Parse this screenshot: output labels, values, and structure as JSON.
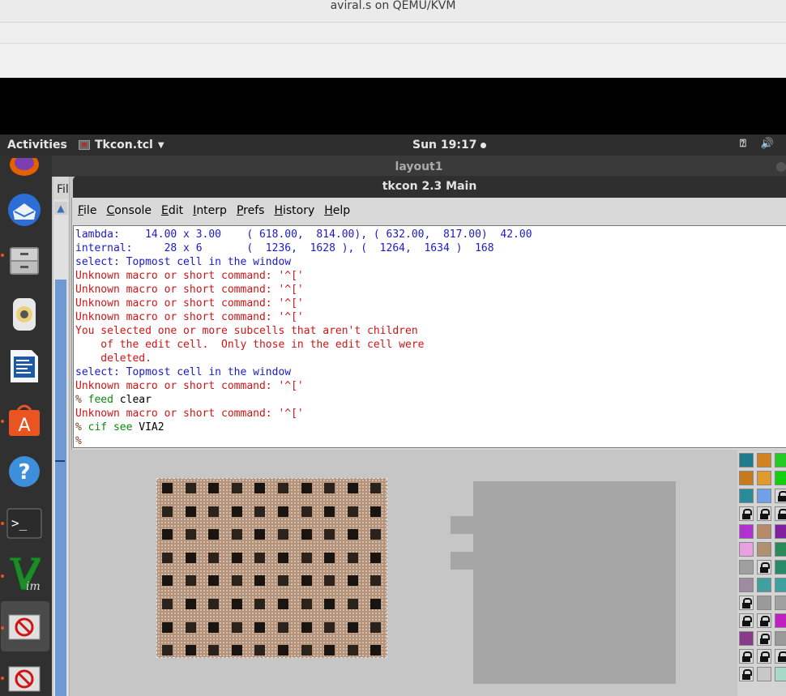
{
  "host": {
    "title": "aviral.s on QEMU/KVM"
  },
  "top_panel": {
    "activities": "Activities",
    "app_name": "Tkcon.tcl",
    "clock": "Sun 19:17"
  },
  "dock": {
    "items": [
      "firefox-icon",
      "thunderbird-icon",
      "files-icon",
      "rhythmbox-icon",
      "writer-icon",
      "software-icon",
      "help-icon",
      "terminal-icon",
      "vim-icon",
      "magic-icon",
      "magic-icon"
    ]
  },
  "layout_window": {
    "title": "layout1",
    "menu_fragment": "Fil"
  },
  "tkcon": {
    "title": "tkcon 2.3 Main",
    "menu": [
      {
        "label": "File",
        "ul": "F",
        "rest": "ile"
      },
      {
        "label": "Console",
        "ul": "C",
        "rest": "onsole"
      },
      {
        "label": "Edit",
        "ul": "E",
        "rest": "dit"
      },
      {
        "label": "Interp",
        "ul": "I",
        "rest": "nterp"
      },
      {
        "label": "Prefs",
        "ul": "P",
        "rest": "refs"
      },
      {
        "label": "History",
        "ul": "H",
        "rest": "istory"
      },
      {
        "label": "Help",
        "ul": "H",
        "rest": "elp"
      }
    ],
    "lines": [
      {
        "kind": "stdout",
        "text": "lambda:    14.00 x 3.00    ( 618.00,  814.00), ( 632.00,  817.00)  42.00"
      },
      {
        "kind": "stdout",
        "text": "internal:     28 x 6       (  1236,  1628 ), (  1264,  1634 )  168"
      },
      {
        "kind": "stdout",
        "text": "select: Topmost cell in the window"
      },
      {
        "kind": "stderr",
        "text": "Unknown macro or short command: '^['"
      },
      {
        "kind": "stderr",
        "text": "Unknown macro or short command: '^['"
      },
      {
        "kind": "stderr",
        "text": "Unknown macro or short command: '^['"
      },
      {
        "kind": "stderr",
        "text": "Unknown macro or short command: '^['"
      },
      {
        "kind": "stderr",
        "text": "You selected one or more subcells that aren't children"
      },
      {
        "kind": "stderr",
        "text": "    of the edit cell.  Only those in the edit cell were"
      },
      {
        "kind": "stderr",
        "text": "    deleted."
      },
      {
        "kind": "stdout",
        "text": "select: Topmost cell in the window"
      },
      {
        "kind": "stderr",
        "text": "Unknown macro or short command: '^['"
      },
      {
        "kind": "prompt",
        "prompt": "% ",
        "cmd": "feed",
        "arg": " clear"
      },
      {
        "kind": "stderr",
        "text": "Unknown macro or short command: '^['"
      },
      {
        "kind": "prompt",
        "prompt": "% ",
        "cmd": "cif see",
        "arg": " VIA2"
      },
      {
        "kind": "prompt",
        "prompt": "%",
        "cmd": "",
        "arg": ""
      }
    ]
  }
}
